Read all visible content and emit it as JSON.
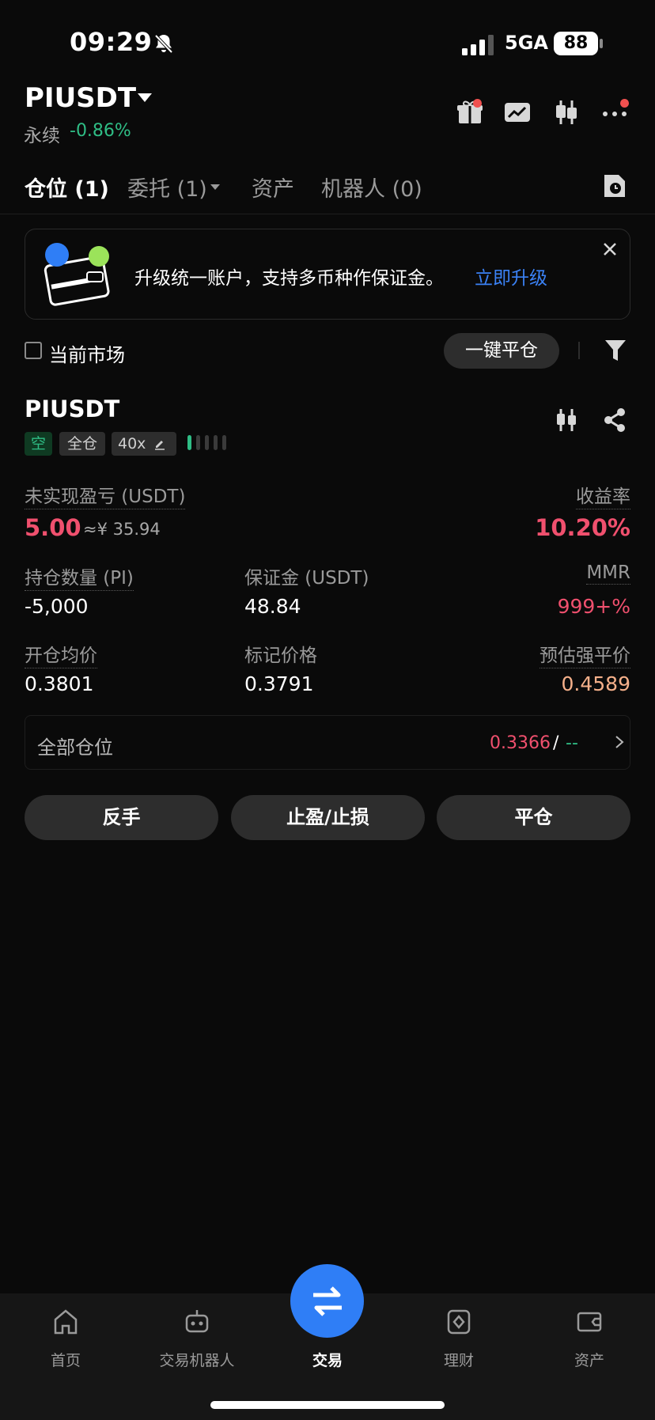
{
  "status_bar": {
    "time": "09:29",
    "network": "5GA",
    "battery": "88"
  },
  "header": {
    "symbol": "PIUSDT",
    "type_label": "永续",
    "change": "-0.86%"
  },
  "tabs": [
    {
      "label": "仓位 (1)"
    },
    {
      "label": "委托 (1)"
    },
    {
      "label": "资产"
    },
    {
      "label": "机器人 (0)"
    }
  ],
  "banner": {
    "text": "升级统一账户，支持多币种作保证金。",
    "link": "立即升级"
  },
  "filter": {
    "current_market": "当前市场",
    "close_all": "一键平仓"
  },
  "position": {
    "symbol": "PIUSDT",
    "side": "空",
    "margin_mode": "全仓",
    "leverage": "40x",
    "unrealized_pnl_label": "未实现盈亏 (USDT)",
    "unrealized_pnl": "5.00",
    "unrealized_pnl_cny": "≈¥ 35.94",
    "roe_label": "收益率",
    "roe": "10.20%",
    "size_label": "持仓数量 (PI)",
    "size": "-5,000",
    "margin_label": "保证金 (USDT)",
    "margin": "48.84",
    "mmr_label": "MMR",
    "mmr": "999+%",
    "entry_label": "开仓均价",
    "entry": "0.3801",
    "mark_label": "标记价格",
    "mark": "0.3791",
    "liq_label": "预估强平价",
    "liq": "0.4589",
    "risk_colors": [
      "#2fbd85",
      "#3a3a3a",
      "#3a3a3a",
      "#3a3a3a",
      "#3a3a3a"
    ]
  },
  "all_positions": {
    "label": "全部仓位",
    "price": "0.3366",
    "slash": "/",
    "dash": "--"
  },
  "actions": {
    "reverse": "反手",
    "tp_sl": "止盈/止损",
    "close": "平仓"
  },
  "nav": [
    {
      "label": "首页",
      "icon": "home-icon"
    },
    {
      "label": "交易机器人",
      "icon": "robot-icon"
    },
    {
      "label": "交易",
      "icon": "swap-icon"
    },
    {
      "label": "理财",
      "icon": "finance-icon"
    },
    {
      "label": "资产",
      "icon": "wallet-icon"
    }
  ],
  "colors": {
    "up": "#2fbd85",
    "down": "#f0506e",
    "accent": "#2f7ef6",
    "liq": "#f5b08a"
  }
}
